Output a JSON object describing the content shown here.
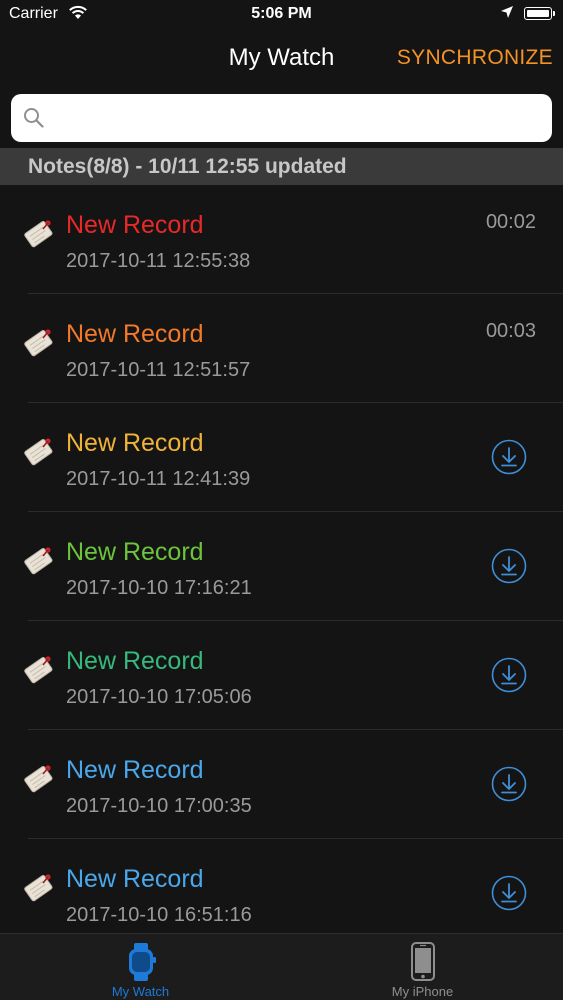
{
  "status_bar": {
    "carrier": "Carrier",
    "time": "5:06 PM",
    "icons": [
      "wifi-icon",
      "location-arrow-icon",
      "battery-icon"
    ]
  },
  "nav": {
    "title": "My Watch",
    "sync_label": "SYNCHRONIZE",
    "sync_color": "#f39325"
  },
  "search": {
    "value": "",
    "placeholder": "",
    "icon": "search-icon"
  },
  "section": {
    "header": "Notes(8/8) - 10/11 12:55 updated"
  },
  "records": [
    {
      "name": "New Record",
      "date": "2017-10-11 12:55:38",
      "duration": "00:02",
      "color": "#e8292a",
      "action": "duration"
    },
    {
      "name": "New Record",
      "date": "2017-10-11 12:51:57",
      "duration": "00:03",
      "color": "#f2792a",
      "action": "duration"
    },
    {
      "name": "New Record",
      "date": "2017-10-11 12:41:39",
      "duration": "",
      "color": "#f0b33a",
      "action": "download"
    },
    {
      "name": "New Record",
      "date": "2017-10-10 17:16:21",
      "duration": "",
      "color": "#6cc43c",
      "action": "download"
    },
    {
      "name": "New Record",
      "date": "2017-10-10 17:05:06",
      "duration": "",
      "color": "#36b97c",
      "action": "download"
    },
    {
      "name": "New Record",
      "date": "2017-10-10 17:00:35",
      "duration": "",
      "color": "#4aa8ea",
      "action": "download"
    },
    {
      "name": "New Record",
      "date": "2017-10-10 16:51:16",
      "duration": "",
      "color": "#4aa8ea",
      "action": "download"
    }
  ],
  "tabs": [
    {
      "label": "My Watch",
      "icon": "watch-icon",
      "active": true
    },
    {
      "label": "My iPhone",
      "icon": "iphone-icon",
      "active": false
    }
  ],
  "colors": {
    "background": "#141414",
    "accent_blue": "#1e7ad9",
    "download_icon": "#3f8fd8",
    "secondary_text": "#9a9a9a"
  }
}
